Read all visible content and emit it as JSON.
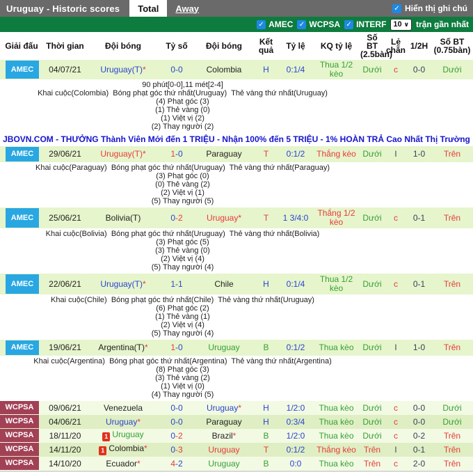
{
  "titlebar": {
    "title": "Uruguay - Historic scores",
    "tabs": [
      {
        "label": "Total",
        "active": true
      },
      {
        "label": "Away",
        "active": false
      }
    ],
    "note_toggle": {
      "label": "Hiển thị ghi chú",
      "checked": true,
      "check_glyph": "✓"
    }
  },
  "filterbar": {
    "checkboxes": [
      {
        "label": "AMEC",
        "checked": true
      },
      {
        "label": "WCPSA",
        "checked": true
      },
      {
        "label": "INTERF",
        "checked": true
      }
    ],
    "check_glyph": "✓",
    "count_select": {
      "value": "10",
      "caret": "∨"
    },
    "suffix": "trận gần nhất"
  },
  "colors": {
    "accent_green_bar": "#0e7c3e",
    "amec_badge": "#29a7e3",
    "wcpsa_badge": "#a24056",
    "checkbox_blue": "#1e88e5",
    "win_red": "#e83a3a",
    "draw_blue": "#2b44cf",
    "loss_green": "#36a036",
    "ad_blue": "#1414cc"
  },
  "ad_line": "JBOVN.COM - THƯỞNG Thành Viên Mới đến 1 TRIỆU - Nhận 100% đến 5 TRIỆU - 1% HOÀN TRẢ Cao Nhất Thị Trường",
  "table": {
    "columns": [
      "Giải đấu",
      "Thời gian",
      "Đội bóng",
      "Tỷ số",
      "Đội bóng",
      "Kết quả",
      "Tỷ lệ",
      "KQ tỷ lệ",
      "Số BT (2.5bàn)",
      "Lẻ chẵn",
      "1/2H",
      "Số BT (0.75bàn)"
    ],
    "rows": [
      {
        "league": "AMEC",
        "date": "04/07/21",
        "shade": "a",
        "min_height": 26,
        "home": {
          "name": "Uruguay(T)",
          "star": true,
          "color": "blue",
          "redcard": false
        },
        "score": {
          "home": "0",
          "away": "0",
          "home_color": "blue",
          "away_color": "blue"
        },
        "away": {
          "name": "Colombia",
          "star": false,
          "color": "dark",
          "redcard": false
        },
        "result": {
          "text": "H",
          "color": "blue"
        },
        "odds": "0:1/4",
        "kq": {
          "text": "Thua 1/2 kèo",
          "color": "green"
        },
        "bt25": {
          "text": "Dưới",
          "color": "green"
        },
        "oddeven": {
          "text": "c",
          "color": "red"
        },
        "half": "0-0",
        "bt075": {
          "text": "Dưới",
          "color": "green"
        },
        "detail": {
          "extra": "90 phút[0-0],11 mét[2-4]",
          "heading": "Khai cuộc(Colombia)  Bóng phạt góc thứ nhất(Uruguay)  Thẻ vàng thứ nhất(Uruguay)",
          "stats": [
            "(4) Phạt góc (3)",
            "(1) Thẻ vàng (0)",
            "(1) Việt vị (2)",
            "(2) Thay người (2)"
          ]
        },
        "ad_after": true
      },
      {
        "league": "AMEC",
        "date": "29/06/21",
        "shade": "a",
        "min_height": 23,
        "home": {
          "name": "Uruguay(T)",
          "star": true,
          "color": "red",
          "redcard": false
        },
        "score": {
          "home": "1",
          "away": "0",
          "home_color": "red",
          "away_color": "blue"
        },
        "away": {
          "name": "Paraguay",
          "star": false,
          "color": "dark",
          "redcard": false
        },
        "result": {
          "text": "T",
          "color": "red"
        },
        "odds": "0:1/2",
        "kq": {
          "text": "Thắng kèo",
          "color": "red"
        },
        "bt25": {
          "text": "Dưới",
          "color": "green"
        },
        "oddeven": {
          "text": "l",
          "color": "navy"
        },
        "half": "1-0",
        "bt075": {
          "text": "Trên",
          "color": "red"
        },
        "detail": {
          "extra": null,
          "heading": "Khai cuộc(Paraguay)  Bóng phạt góc thứ nhất(Uruguay)  Thẻ vàng thứ nhất(Paraguay)",
          "stats": [
            "(3) Phạt góc (0)",
            "(0) Thẻ vàng (2)",
            "(2) Việt vị (1)",
            "(5) Thay người (5)"
          ]
        },
        "ad_after": false
      },
      {
        "league": "AMEC",
        "date": "25/06/21",
        "shade": "a",
        "min_height": 30,
        "home": {
          "name": "Bolivia(T)",
          "star": false,
          "color": "dark",
          "redcard": false
        },
        "score": {
          "home": "0",
          "away": "2",
          "home_color": "blue",
          "away_color": "red"
        },
        "away": {
          "name": "Uruguay",
          "star": true,
          "color": "red",
          "redcard": false
        },
        "result": {
          "text": "T",
          "color": "red"
        },
        "odds": "1 3/4:0",
        "kq": {
          "text": "Thắng 1/2 kèo",
          "color": "red"
        },
        "bt25": {
          "text": "Dưới",
          "color": "green"
        },
        "oddeven": {
          "text": "c",
          "color": "red"
        },
        "half": "0-1",
        "bt075": {
          "text": "Trên",
          "color": "red"
        },
        "detail": {
          "extra": null,
          "heading": "Khai cuộc(Bolivia)  Bóng phạt góc thứ nhất(Uruguay)  Thẻ vàng thứ nhất(Bolivia)",
          "stats": [
            "(3) Phạt góc (5)",
            "(3) Thẻ vàng (0)",
            "(2) Việt vị (4)",
            "(5) Thay người (4)"
          ]
        },
        "ad_after": false
      },
      {
        "league": "AMEC",
        "date": "22/06/21",
        "shade": "a",
        "min_height": 30,
        "home": {
          "name": "Uruguay(T)",
          "star": true,
          "color": "blue",
          "redcard": false
        },
        "score": {
          "home": "1",
          "away": "1",
          "home_color": "blue",
          "away_color": "blue"
        },
        "away": {
          "name": "Chile",
          "star": false,
          "color": "dark",
          "redcard": false
        },
        "result": {
          "text": "H",
          "color": "blue"
        },
        "odds": "0:1/4",
        "kq": {
          "text": "Thua 1/2 kèo",
          "color": "green"
        },
        "bt25": {
          "text": "Dưới",
          "color": "green"
        },
        "oddeven": {
          "text": "c",
          "color": "red"
        },
        "half": "0-1",
        "bt075": {
          "text": "Trên",
          "color": "red"
        },
        "detail": {
          "extra": null,
          "heading": "Khai cuộc(Chile)  Bóng phạt góc thứ nhất(Chile)  Thẻ vàng thứ nhất(Uruguay)",
          "stats": [
            "(6) Phạt góc (2)",
            "(1) Thẻ vàng (1)",
            "(2) Việt vị (4)",
            "(5) Thay người (4)"
          ]
        },
        "ad_after": false
      },
      {
        "league": "AMEC",
        "date": "19/06/21",
        "shade": "a",
        "min_height": 23,
        "home": {
          "name": "Argentina(T)",
          "star": true,
          "color": "dark",
          "redcard": false
        },
        "score": {
          "home": "1",
          "away": "0",
          "home_color": "red",
          "away_color": "blue"
        },
        "away": {
          "name": "Uruguay",
          "star": false,
          "color": "green",
          "redcard": false
        },
        "result": {
          "text": "B",
          "color": "green"
        },
        "odds": "0:1/2",
        "kq": {
          "text": "Thua kèo",
          "color": "green"
        },
        "bt25": {
          "text": "Dưới",
          "color": "green"
        },
        "oddeven": {
          "text": "l",
          "color": "navy"
        },
        "half": "1-0",
        "bt075": {
          "text": "Trên",
          "color": "red"
        },
        "detail": {
          "extra": null,
          "heading": "Khai cuộc(Argentina)  Bóng phạt góc thứ nhất(Argentina)  Thẻ vàng thứ nhất(Argentina)",
          "stats": [
            "(8) Phạt góc (3)",
            "(3) Thẻ vàng (2)",
            "(1) Việt vị (0)",
            "(4) Thay người (5)"
          ]
        },
        "ad_after": false
      },
      {
        "league": "WCPSA",
        "date": "09/06/21",
        "shade": "b",
        "min_height": 20,
        "home": {
          "name": "Venezuela",
          "star": false,
          "color": "dark",
          "redcard": false
        },
        "score": {
          "home": "0",
          "away": "0",
          "home_color": "blue",
          "away_color": "blue"
        },
        "away": {
          "name": "Uruguay",
          "star": true,
          "color": "blue",
          "redcard": false
        },
        "result": {
          "text": "H",
          "color": "blue"
        },
        "odds": "1/2:0",
        "kq": {
          "text": "Thua kèo",
          "color": "green"
        },
        "bt25": {
          "text": "Dưới",
          "color": "green"
        },
        "oddeven": {
          "text": "c",
          "color": "red"
        },
        "half": "0-0",
        "bt075": {
          "text": "Dưới",
          "color": "green"
        },
        "detail": null,
        "ad_after": false
      },
      {
        "league": "WCPSA",
        "date": "04/06/21",
        "shade": "c",
        "min_height": 20,
        "home": {
          "name": "Uruguay",
          "star": true,
          "color": "blue",
          "redcard": false
        },
        "score": {
          "home": "0",
          "away": "0",
          "home_color": "blue",
          "away_color": "blue"
        },
        "away": {
          "name": "Paraguay",
          "star": false,
          "color": "dark",
          "redcard": false
        },
        "result": {
          "text": "H",
          "color": "blue"
        },
        "odds": "0:3/4",
        "kq": {
          "text": "Thua kèo",
          "color": "green"
        },
        "bt25": {
          "text": "Dưới",
          "color": "green"
        },
        "oddeven": {
          "text": "c",
          "color": "red"
        },
        "half": "0-0",
        "bt075": {
          "text": "Dưới",
          "color": "green"
        },
        "detail": null,
        "ad_after": false
      },
      {
        "league": "WCPSA",
        "date": "18/11/20",
        "shade": "b",
        "min_height": 20,
        "home": {
          "name": "Uruguay",
          "star": false,
          "color": "green",
          "redcard": true,
          "redcard_count": "1"
        },
        "score": {
          "home": "0",
          "away": "2",
          "home_color": "blue",
          "away_color": "red"
        },
        "away": {
          "name": "Brazil",
          "star": true,
          "color": "dark",
          "redcard": false
        },
        "result": {
          "text": "B",
          "color": "green"
        },
        "odds": "1/2:0",
        "kq": {
          "text": "Thua kèo",
          "color": "green"
        },
        "bt25": {
          "text": "Dưới",
          "color": "green"
        },
        "oddeven": {
          "text": "c",
          "color": "red"
        },
        "half": "0-2",
        "bt075": {
          "text": "Trên",
          "color": "red"
        },
        "detail": null,
        "ad_after": false
      },
      {
        "league": "WCPSA",
        "date": "14/11/20",
        "shade": "c",
        "min_height": 20,
        "home": {
          "name": "Colombia",
          "star": true,
          "color": "dark",
          "redcard": true,
          "redcard_count": "1"
        },
        "score": {
          "home": "0",
          "away": "3",
          "home_color": "blue",
          "away_color": "red"
        },
        "away": {
          "name": "Uruguay",
          "star": false,
          "color": "red",
          "redcard": false
        },
        "result": {
          "text": "T",
          "color": "red"
        },
        "odds": "0:1/2",
        "kq": {
          "text": "Thắng kèo",
          "color": "red"
        },
        "bt25": {
          "text": "Trên",
          "color": "red"
        },
        "oddeven": {
          "text": "l",
          "color": "navy"
        },
        "half": "0-1",
        "bt075": {
          "text": "Trên",
          "color": "red"
        },
        "detail": null,
        "ad_after": false
      },
      {
        "league": "WCPSA",
        "date": "14/10/20",
        "shade": "b",
        "min_height": 20,
        "home": {
          "name": "Ecuador",
          "star": true,
          "color": "dark",
          "redcard": false
        },
        "score": {
          "home": "4",
          "away": "2",
          "home_color": "red",
          "away_color": "blue"
        },
        "away": {
          "name": "Uruguay",
          "star": false,
          "color": "green",
          "redcard": false
        },
        "result": {
          "text": "B",
          "color": "green"
        },
        "odds": "0:0",
        "kq": {
          "text": "Thua kèo",
          "color": "green"
        },
        "bt25": {
          "text": "Trên",
          "color": "red"
        },
        "oddeven": {
          "text": "c",
          "color": "red"
        },
        "half": "2-0",
        "bt075": {
          "text": "Trên",
          "color": "red"
        },
        "detail": null,
        "ad_after": false
      }
    ]
  }
}
